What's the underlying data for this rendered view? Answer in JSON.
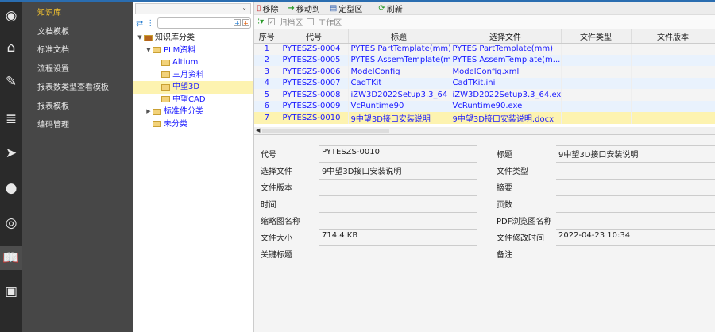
{
  "sidebar_icons": [
    "search-logo-icon",
    "home-icon",
    "edit-icon",
    "database-icon",
    "send-icon",
    "chat-icon",
    "podcast-icon",
    "book-icon",
    "id-card-icon"
  ],
  "nav": {
    "items": [
      "知识库",
      "文档模板",
      "标准文档",
      "流程设置",
      "报表数类型查看模板",
      "报表模板",
      "编码管理"
    ],
    "selected": 0
  },
  "tree": {
    "combo_value": "",
    "search_placeholder": "",
    "nodes": [
      {
        "label": "知识库分类",
        "level": 0,
        "toggle": "▼",
        "root": true
      },
      {
        "label": "PLM资料",
        "level": 1,
        "toggle": "▼"
      },
      {
        "label": "Altium",
        "level": 2,
        "toggle": ""
      },
      {
        "label": "三月资料",
        "level": 2,
        "toggle": ""
      },
      {
        "label": "中望3D",
        "level": 2,
        "toggle": "",
        "selected": true
      },
      {
        "label": "中望CAD",
        "level": 2,
        "toggle": ""
      },
      {
        "label": "标准件分类",
        "level": 1,
        "toggle": "▶"
      },
      {
        "label": "未分类",
        "level": 1,
        "toggle": ""
      }
    ]
  },
  "toolbar": {
    "remove": "移除",
    "move_to": "移动到",
    "customize": "定型区",
    "refresh": "刷新"
  },
  "filter": {
    "archive": "归档区",
    "archive_checked": true,
    "work": "工作区",
    "work_checked": false
  },
  "table": {
    "columns": [
      "序号",
      "代号",
      "标题",
      "选择文件",
      "文件类型",
      "文件版本"
    ],
    "rows": [
      [
        "1",
        "PYTESZS-0004",
        "PYTES PartTemplate(mm)",
        "PYTES PartTemplate(mm)",
        "",
        ""
      ],
      [
        "2",
        "PYTESZS-0005",
        "PYTES AssemTemplate(mm)",
        "PYTES AssemTemplate(m...",
        "",
        ""
      ],
      [
        "3",
        "PYTESZS-0006",
        "ModelConfig",
        "ModelConfig.xml",
        "",
        ""
      ],
      [
        "4",
        "PYTESZS-0007",
        "CadTKit",
        "CadTKit.ini",
        "",
        ""
      ],
      [
        "5",
        "PYTESZS-0008",
        "iZW3D2022Setup3.3_64",
        "iZW3D2022Setup3.3_64.exe",
        "",
        ""
      ],
      [
        "6",
        "PYTESZS-0009",
        "VcRuntime90",
        "VcRuntime90.exe",
        "",
        ""
      ],
      [
        "7",
        "PYTESZS-0010",
        "9中望3D接口安装说明",
        "9中望3D接口安装说明.docx",
        "",
        ""
      ]
    ],
    "selected_row": 6
  },
  "form": {
    "rows": [
      [
        {
          "label": "代号",
          "value": "PYTESZS-0010"
        },
        {
          "label": "标题",
          "value": "9中望3D接口安装说明"
        }
      ],
      [
        {
          "label": "选择文件",
          "value": "9中望3D接口安装说明"
        },
        {
          "label": "文件类型",
          "value": ""
        }
      ],
      [
        {
          "label": "文件版本",
          "value": ""
        },
        {
          "label": "摘要",
          "value": ""
        }
      ],
      [
        {
          "label": "时间",
          "value": ""
        },
        {
          "label": "页数",
          "value": ""
        }
      ],
      [
        {
          "label": "缩略图名称",
          "value": ""
        },
        {
          "label": "PDF浏览图名称",
          "value": ""
        }
      ],
      [
        {
          "label": "文件大小",
          "value": "714.4 KB"
        },
        {
          "label": "文件修改时间",
          "value": "2022-04-23 10:34"
        }
      ],
      [
        {
          "label": "关键标题",
          "value": ""
        },
        {
          "label": "备注",
          "value": ""
        }
      ]
    ]
  }
}
